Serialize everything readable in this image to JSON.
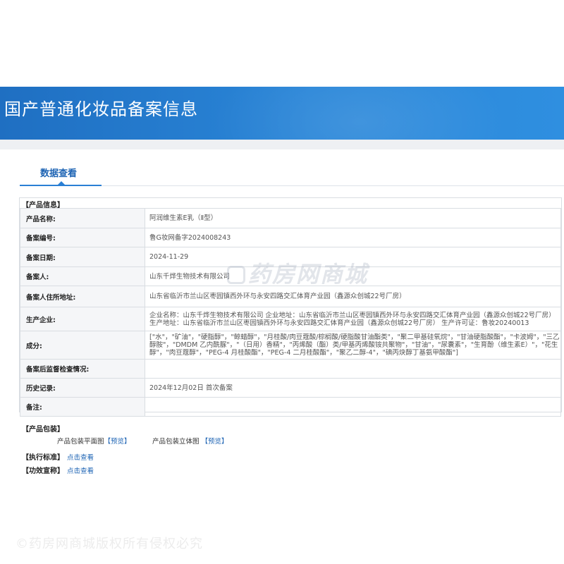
{
  "header": {
    "title": "国产普通化妆品备案信息"
  },
  "tabs": [
    {
      "label": "数据查看"
    }
  ],
  "product_info": {
    "section_title": "【产品信息】",
    "rows": [
      {
        "label": "产品名称:",
        "value": "阿润维生素E乳（Ⅱ型）"
      },
      {
        "label": "备案编号:",
        "value": "鲁G妆网备字2024008243"
      },
      {
        "label": "备案日期:",
        "value": "2024-11-29"
      },
      {
        "label": "备案人:",
        "value": "山东千烨生物技术有限公司"
      },
      {
        "label": "备案人住所地址:",
        "value": "山东省临沂市兰山区枣园镇西外环与永安四路交汇体育产业园（鑫源众创城22号厂房）"
      },
      {
        "label": "生产企业:",
        "lines": [
          "企业名称：山东千烨生物技术有限公司 企业地址：山东省临沂市兰山区枣园镇西外环与永安四路交汇体育产业园（鑫源众创城22号厂房）",
          "生产地址：山东省临沂市兰山区枣园镇西外环与永安四路交汇体育产业园（鑫源众创城22号厂房） 生产许可证：鲁妆20240013"
        ]
      },
      {
        "label": "成分:",
        "lines": [
          "[\"水\"，\"矿油\"，\"硬脂醇\"，\"鲸蜡醇\"，\"月桂酸/肉豆蔻酸/棕榈酸/硬脂酸甘油酯类\"，\"聚二甲基硅氧烷\"，\"甘油硬脂酸酯\"，\"卡波姆\"，\"三乙",
          "醇胺\"，\"DMDM 乙内酰脲\"，\"（日用）香精\"，\"丙烯酸（酯）类/甲基丙烯酸铵共聚物\"，\"甘油\"，\"尿囊素\"，\"生育酚（维生素E）\"，\"花生",
          "醇\"，\"肉豆蔻醇\"，\"PEG-4 月桂酸酯\"，\"PEG-4 二月桂酸酯\"，\"聚乙二醇-4\"，\"碘丙炔醇丁基氨甲酸酯\"]"
        ]
      },
      {
        "label": "备案后监督检查情况:",
        "value": ""
      },
      {
        "label": "历史记录:",
        "value": "2024年12月02日 首次备案"
      },
      {
        "label": "备注:",
        "value": ""
      }
    ]
  },
  "watermark": {
    "text": "药房网商城"
  },
  "packaging": {
    "section_title": "【产品包装】",
    "flat_label": "产品包装平面图",
    "flat_link": "【预览】",
    "solid_label": "产品包装立体图",
    "solid_link": "【预览】"
  },
  "standards": [
    {
      "label": "【执行标准】",
      "link": "点击查看"
    },
    {
      "label": "【功效宣称】",
      "link": "点击查看"
    }
  ],
  "footer": {
    "copyright": "©药房网商城版权所有侵权必究"
  }
}
